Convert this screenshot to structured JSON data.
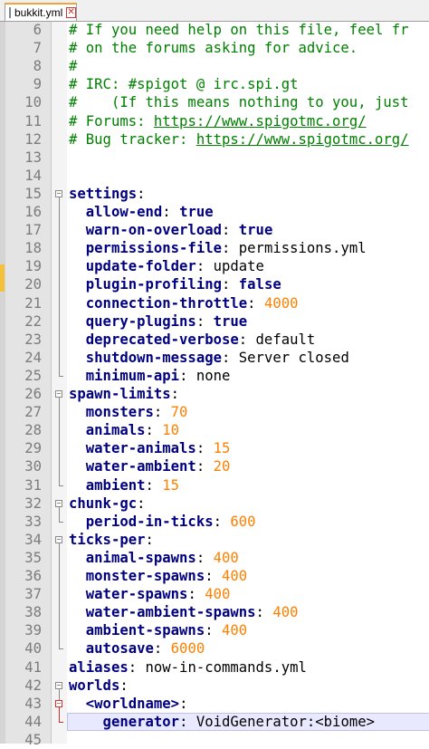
{
  "tab": {
    "title": "bukkit.yml",
    "close_symbol": "✕"
  },
  "lines": [
    {
      "n": "6",
      "segs": [
        {
          "t": "# If you need help on this file, feel fr",
          "c": "comment"
        }
      ]
    },
    {
      "n": "7",
      "segs": [
        {
          "t": "# on the forums asking for advice.",
          "c": "comment"
        }
      ]
    },
    {
      "n": "8",
      "segs": [
        {
          "t": "#",
          "c": "comment"
        }
      ]
    },
    {
      "n": "9",
      "segs": [
        {
          "t": "# IRC: #spigot @ irc.spi.gt",
          "c": "comment"
        }
      ]
    },
    {
      "n": "10",
      "segs": [
        {
          "t": "#    (If this means nothing to you, just",
          "c": "comment"
        }
      ]
    },
    {
      "n": "11",
      "segs": [
        {
          "t": "# Forums: ",
          "c": "comment"
        },
        {
          "t": "https://www.spigotmc.org/",
          "c": "link"
        }
      ]
    },
    {
      "n": "12",
      "segs": [
        {
          "t": "# Bug tracker: ",
          "c": "comment"
        },
        {
          "t": "https://www.spigotmc.org/",
          "c": "link"
        }
      ]
    },
    {
      "n": "13",
      "segs": []
    },
    {
      "n": "14",
      "segs": []
    },
    {
      "n": "15",
      "segs": [
        {
          "t": "settings",
          "c": "key"
        },
        {
          "t": ":",
          "c": "colon"
        }
      ]
    },
    {
      "n": "16",
      "segs": [
        {
          "t": "  allow-end",
          "c": "key"
        },
        {
          "t": ": ",
          "c": "colon"
        },
        {
          "t": "true",
          "c": "bool"
        }
      ]
    },
    {
      "n": "17",
      "segs": [
        {
          "t": "  warn-on-overload",
          "c": "key"
        },
        {
          "t": ": ",
          "c": "colon"
        },
        {
          "t": "true",
          "c": "bool"
        }
      ]
    },
    {
      "n": "18",
      "segs": [
        {
          "t": "  permissions-file",
          "c": "key"
        },
        {
          "t": ": ",
          "c": "colon"
        },
        {
          "t": "permissions.yml",
          "c": "str"
        }
      ]
    },
    {
      "n": "19",
      "segs": [
        {
          "t": "  update-folder",
          "c": "key"
        },
        {
          "t": ": ",
          "c": "colon"
        },
        {
          "t": "update",
          "c": "str"
        }
      ]
    },
    {
      "n": "20",
      "segs": [
        {
          "t": "  plugin-profiling",
          "c": "key"
        },
        {
          "t": ": ",
          "c": "colon"
        },
        {
          "t": "false",
          "c": "bool"
        }
      ]
    },
    {
      "n": "21",
      "segs": [
        {
          "t": "  connection-throttle",
          "c": "key"
        },
        {
          "t": ": ",
          "c": "colon"
        },
        {
          "t": "4000",
          "c": "num"
        }
      ]
    },
    {
      "n": "22",
      "segs": [
        {
          "t": "  query-plugins",
          "c": "key"
        },
        {
          "t": ": ",
          "c": "colon"
        },
        {
          "t": "true",
          "c": "bool"
        }
      ]
    },
    {
      "n": "23",
      "segs": [
        {
          "t": "  deprecated-verbose",
          "c": "key"
        },
        {
          "t": ": ",
          "c": "colon"
        },
        {
          "t": "default",
          "c": "str"
        }
      ]
    },
    {
      "n": "24",
      "segs": [
        {
          "t": "  shutdown-message",
          "c": "key"
        },
        {
          "t": ": ",
          "c": "colon"
        },
        {
          "t": "Server closed",
          "c": "str"
        }
      ]
    },
    {
      "n": "25",
      "segs": [
        {
          "t": "  minimum-api",
          "c": "key"
        },
        {
          "t": ": ",
          "c": "colon"
        },
        {
          "t": "none",
          "c": "str"
        }
      ]
    },
    {
      "n": "26",
      "segs": [
        {
          "t": "spawn-limits",
          "c": "key"
        },
        {
          "t": ":",
          "c": "colon"
        }
      ]
    },
    {
      "n": "27",
      "segs": [
        {
          "t": "  monsters",
          "c": "key"
        },
        {
          "t": ": ",
          "c": "colon"
        },
        {
          "t": "70",
          "c": "num"
        }
      ]
    },
    {
      "n": "28",
      "segs": [
        {
          "t": "  animals",
          "c": "key"
        },
        {
          "t": ": ",
          "c": "colon"
        },
        {
          "t": "10",
          "c": "num"
        }
      ]
    },
    {
      "n": "29",
      "segs": [
        {
          "t": "  water-animals",
          "c": "key"
        },
        {
          "t": ": ",
          "c": "colon"
        },
        {
          "t": "15",
          "c": "num"
        }
      ]
    },
    {
      "n": "30",
      "segs": [
        {
          "t": "  water-ambient",
          "c": "key"
        },
        {
          "t": ": ",
          "c": "colon"
        },
        {
          "t": "20",
          "c": "num"
        }
      ]
    },
    {
      "n": "31",
      "segs": [
        {
          "t": "  ambient",
          "c": "key"
        },
        {
          "t": ": ",
          "c": "colon"
        },
        {
          "t": "15",
          "c": "num"
        }
      ]
    },
    {
      "n": "32",
      "segs": [
        {
          "t": "chunk-gc",
          "c": "key"
        },
        {
          "t": ":",
          "c": "colon"
        }
      ]
    },
    {
      "n": "33",
      "segs": [
        {
          "t": "  period-in-ticks",
          "c": "key"
        },
        {
          "t": ": ",
          "c": "colon"
        },
        {
          "t": "600",
          "c": "num"
        }
      ]
    },
    {
      "n": "34",
      "segs": [
        {
          "t": "ticks-per",
          "c": "key"
        },
        {
          "t": ":",
          "c": "colon"
        }
      ]
    },
    {
      "n": "35",
      "segs": [
        {
          "t": "  animal-spawns",
          "c": "key"
        },
        {
          "t": ": ",
          "c": "colon"
        },
        {
          "t": "400",
          "c": "num"
        }
      ]
    },
    {
      "n": "36",
      "segs": [
        {
          "t": "  monster-spawns",
          "c": "key"
        },
        {
          "t": ": ",
          "c": "colon"
        },
        {
          "t": "400",
          "c": "num"
        }
      ]
    },
    {
      "n": "37",
      "segs": [
        {
          "t": "  water-spawns",
          "c": "key"
        },
        {
          "t": ": ",
          "c": "colon"
        },
        {
          "t": "400",
          "c": "num"
        }
      ]
    },
    {
      "n": "38",
      "segs": [
        {
          "t": "  water-ambient-spawns",
          "c": "key"
        },
        {
          "t": ": ",
          "c": "colon"
        },
        {
          "t": "400",
          "c": "num"
        }
      ]
    },
    {
      "n": "39",
      "segs": [
        {
          "t": "  ambient-spawns",
          "c": "key"
        },
        {
          "t": ": ",
          "c": "colon"
        },
        {
          "t": "400",
          "c": "num"
        }
      ]
    },
    {
      "n": "40",
      "segs": [
        {
          "t": "  autosave",
          "c": "key"
        },
        {
          "t": ": ",
          "c": "colon"
        },
        {
          "t": "6000",
          "c": "num"
        }
      ]
    },
    {
      "n": "41",
      "segs": [
        {
          "t": "aliases",
          "c": "key"
        },
        {
          "t": ": ",
          "c": "colon"
        },
        {
          "t": "now-in-commands.yml",
          "c": "str"
        }
      ]
    },
    {
      "n": "42",
      "segs": [
        {
          "t": "worlds",
          "c": "key"
        },
        {
          "t": ":",
          "c": "colon"
        }
      ]
    },
    {
      "n": "43",
      "segs": [
        {
          "t": "  <worldname>",
          "c": "key"
        },
        {
          "t": ":",
          "c": "colon"
        }
      ]
    },
    {
      "n": "44",
      "segs": [
        {
          "t": "    generator",
          "c": "key"
        },
        {
          "t": ": ",
          "c": "colon"
        },
        {
          "t": "VoidGenerator:<biome>",
          "c": "str"
        }
      ]
    },
    {
      "n": "45",
      "segs": []
    }
  ],
  "current_line": "44",
  "colors": {
    "comment": "#008000",
    "key": "#000080",
    "number": "#ff8000",
    "fold_active": "#d23030"
  }
}
